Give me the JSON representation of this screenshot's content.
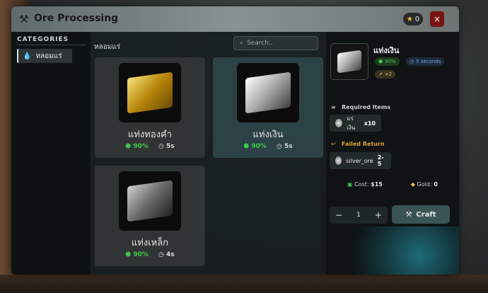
{
  "window": {
    "title": "Ore Processing",
    "star_count": "0",
    "close_label": "×"
  },
  "sidebar": {
    "heading": "CATEGORIES",
    "items": [
      {
        "label": "หลอมแร่",
        "icon": "droplet-icon"
      }
    ]
  },
  "main": {
    "section_title": "หลอมแร่",
    "search": {
      "placeholder": "Search..",
      "value": ""
    },
    "cards": [
      {
        "name": "แท่งทองคำ",
        "rate": "90%",
        "time": "5s",
        "icon": "gold-bar-icon"
      },
      {
        "name": "แท่งเงิน",
        "rate": "90%",
        "time": "5s",
        "icon": "silver-bar-icon",
        "selected": true
      },
      {
        "name": "แท่งเหล็ก",
        "rate": "90%",
        "time": "4s",
        "icon": "iron-bar-icon"
      }
    ]
  },
  "details": {
    "name": "แท่งเงิน",
    "rate": "90%",
    "time": "5 seconds",
    "xp": "+2",
    "required_heading": "Required Items",
    "required": {
      "item": "แร่เงิน",
      "qty": "x10"
    },
    "failed_heading": "Failed Return",
    "failed": {
      "item": "silver_ore",
      "qty": "2-5"
    },
    "cost_label": "Cost:",
    "cost_value": "$15",
    "gold_label": "Gold:",
    "gold_value": "0",
    "quantity": "1",
    "minus": "−",
    "plus": "+",
    "craft_label": "Craft"
  },
  "colors": {
    "accent_green": "#3ec94d",
    "accent_blue": "#6fa3e8",
    "close_red": "#7a1414"
  }
}
